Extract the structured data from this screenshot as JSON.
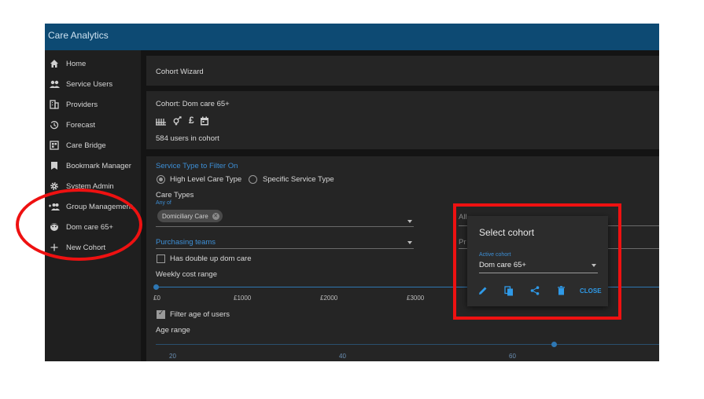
{
  "app": {
    "title": "Care Analytics"
  },
  "sidebar": {
    "items": [
      {
        "label": "Home",
        "icon": "home-icon"
      },
      {
        "label": "Service Users",
        "icon": "people-icon"
      },
      {
        "label": "Providers",
        "icon": "building-icon"
      },
      {
        "label": "Forecast",
        "icon": "history-icon"
      },
      {
        "label": "Care Bridge",
        "icon": "grid-icon"
      },
      {
        "label": "Bookmark Manager",
        "icon": "bookmark-icon"
      },
      {
        "label": "System Admin",
        "icon": "gear-icon"
      },
      {
        "label": "Group Management",
        "icon": "group-add-icon"
      },
      {
        "label": "Dom care 65+",
        "icon": "face-icon"
      },
      {
        "label": "New Cohort",
        "icon": "plus-icon"
      }
    ]
  },
  "wizard": {
    "title": "Cohort Wizard"
  },
  "cohort": {
    "title": "Cohort: Dom care 65+",
    "users_text": "584 users in cohort",
    "icons": [
      "factory-icon",
      "gender-icon",
      "pound-icon",
      "calendar-icon"
    ]
  },
  "filters": {
    "section_title": "Service Type to Filter On",
    "radio_high_level": "High Level Care Type",
    "radio_specific": "Specific Service Type",
    "care_types_label": "Care Types",
    "care_types_sub": "Any of",
    "chip_domiciliary": "Domiciliary Care",
    "all_partial": "All",
    "purchasing_label": "Purchasing teams",
    "pr_partial": "Pr",
    "double_up_label": "Has double up dom care",
    "weekly_cost_label": "Weekly cost range",
    "cost_ticks": [
      "£0",
      "£1000",
      "£2000",
      "£3000"
    ],
    "filter_age_label": "Filter age of users",
    "age_range_label": "Age range",
    "age_ticks": [
      "20",
      "40",
      "60"
    ],
    "high_level_selected": true,
    "filter_age_checked": true,
    "double_up_checked": false
  },
  "dialog": {
    "title": "Select cohort",
    "active_label": "Active cohort",
    "active_value": "Dom care 65+",
    "close_label": "CLOSE",
    "actions": [
      "edit-icon",
      "copy-icon",
      "share-icon",
      "delete-icon"
    ]
  },
  "colors": {
    "topbar": "#0d4a73",
    "accent": "#3d8fd6",
    "annotation": "#ee1111"
  }
}
